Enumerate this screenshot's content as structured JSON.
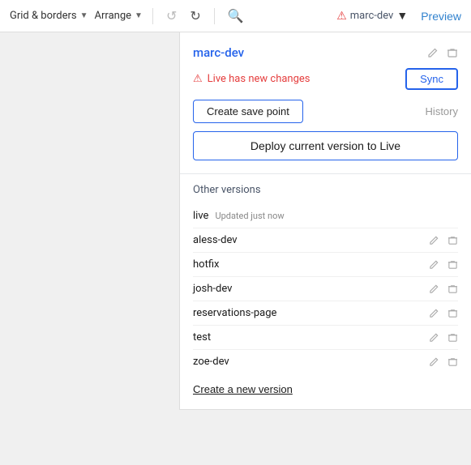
{
  "toolbar": {
    "grid_borders_label": "Grid & borders",
    "arrange_label": "Arrange",
    "undo_label": "Undo",
    "redo_label": "Redo",
    "search_label": "Search",
    "alert_icon_label": "Alert",
    "brand_name": "marc-dev",
    "preview_label": "Preview"
  },
  "panel": {
    "title": "marc-dev",
    "warning_text": "Live has new changes",
    "sync_label": "Sync",
    "save_point_label": "Create save point",
    "history_label": "History",
    "deploy_label": "Deploy current version to Live",
    "other_versions_title": "Other versions",
    "create_new_label": "Create a new version",
    "versions": [
      {
        "name": "live",
        "badge": "Updated just now",
        "has_icons": false
      },
      {
        "name": "aless-dev",
        "badge": "",
        "has_icons": true
      },
      {
        "name": "hotfix",
        "badge": "",
        "has_icons": true
      },
      {
        "name": "josh-dev",
        "badge": "",
        "has_icons": true
      },
      {
        "name": "reservations-page",
        "badge": "",
        "has_icons": true
      },
      {
        "name": "test",
        "badge": "",
        "has_icons": true
      },
      {
        "name": "zoe-dev",
        "badge": "",
        "has_icons": true
      }
    ]
  },
  "colors": {
    "blue": "#2563eb",
    "red": "#e53e3e",
    "gray": "#888",
    "light_gray": "#f0f0f0"
  }
}
